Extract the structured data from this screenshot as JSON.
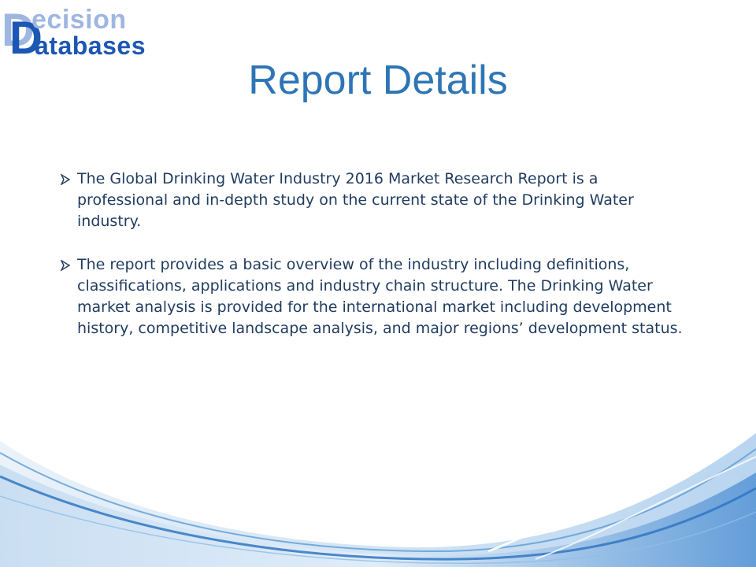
{
  "logo": {
    "line1": "ecision",
    "line2": "atabases",
    "initial": "D"
  },
  "slide": {
    "title": "Report Details"
  },
  "bullets": [
    {
      "text": "The Global Drinking Water Industry 2016 Market Research Report is a professional and in-depth study on the current state of the Drinking Water industry."
    },
    {
      "text": "The report provides a basic overview of the industry including definitions, classifications, applications and industry chain structure. The Drinking Water market analysis is provided for the international market including development history, competitive landscape analysis, and major regions’ development status."
    }
  ],
  "colors": {
    "title": "#2e75b6",
    "logo_dark": "#1d57b4",
    "logo_light": "#9fb6e0",
    "body_text": "#1f3b5f",
    "wave": "#5b9bd5"
  },
  "icons": {
    "bullet": "arrow-bullet-icon"
  }
}
